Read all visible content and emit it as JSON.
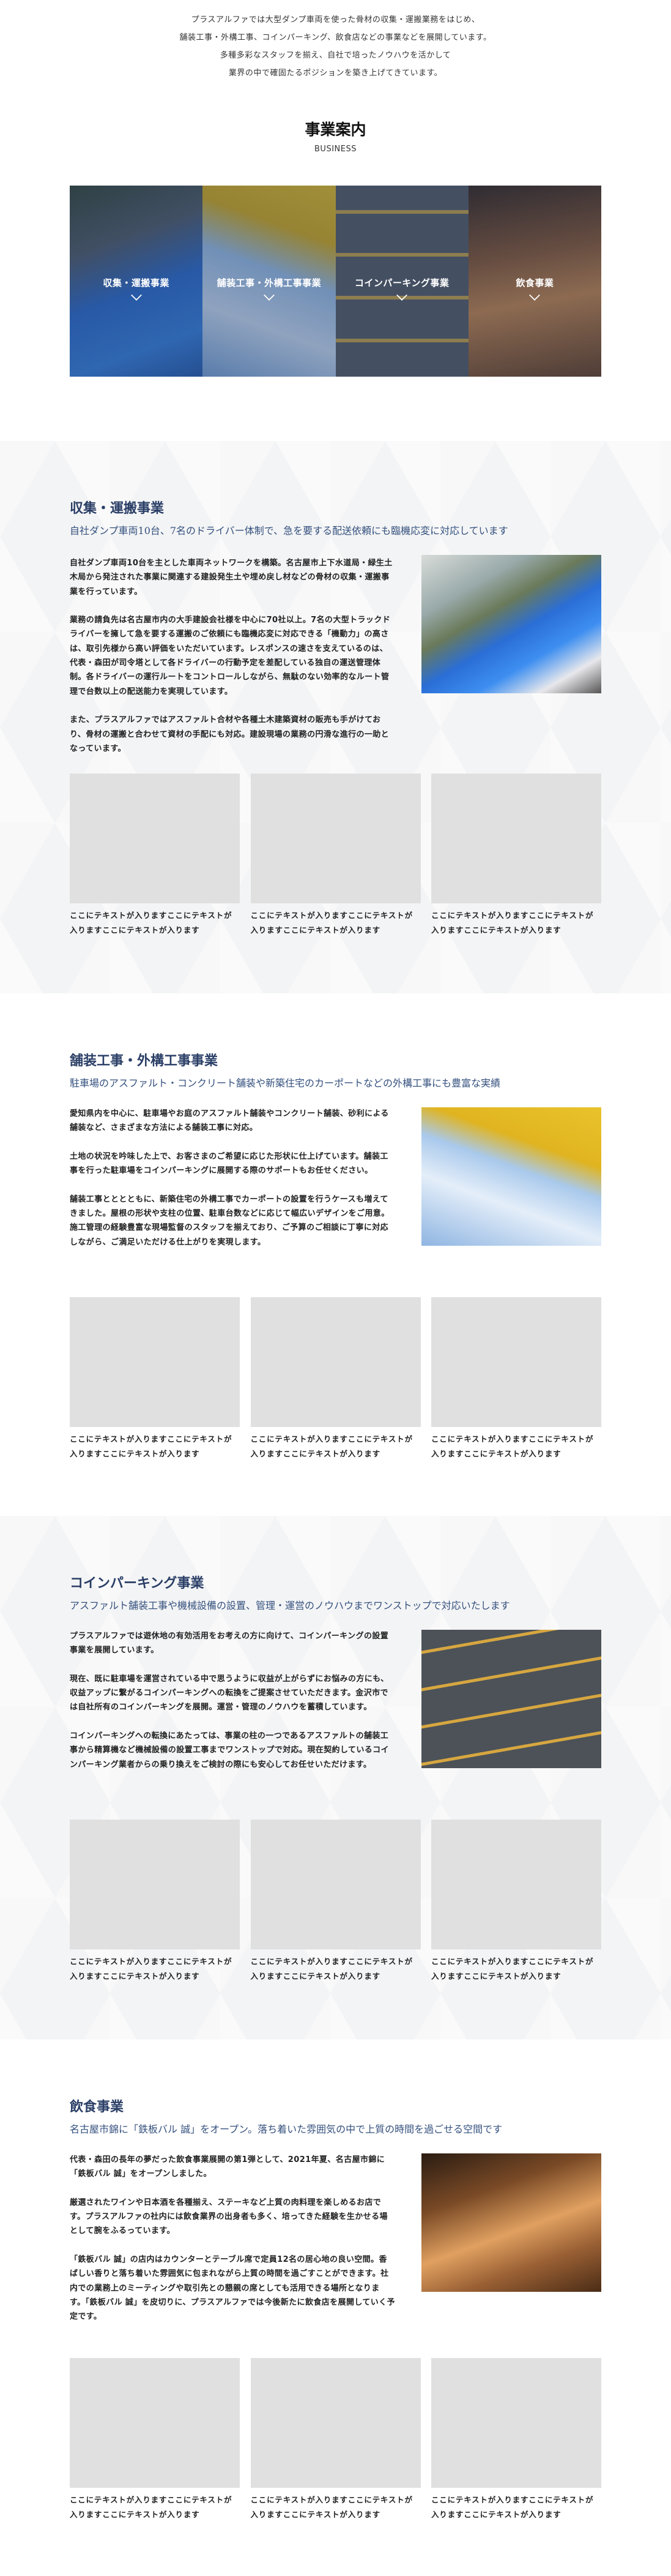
{
  "intro": {
    "lines": [
      "プラスアルファでは大型ダンプ車両を使った骨材の収集・運搬業務をはじめ、",
      "舗装工事・外構工事、コインパーキング、飲食店などの事業などを展開しています。",
      "多種多彩なスタッフを揃え、自社で培ったノウハウを活かして",
      "業界の中で確固たるポジションを築き上げてきています。"
    ]
  },
  "business": {
    "title": "事業案内",
    "subtitle": "BUSINESS",
    "tiles": [
      {
        "label": "収集・運搬事業"
      },
      {
        "label": "舗装工事・外構工事事業"
      },
      {
        "label": "コインパーキング事業"
      },
      {
        "label": "飲食事業"
      }
    ]
  },
  "sections": [
    {
      "title": "収集・運搬事業",
      "subtitle": "自社ダンプ車両10台、7名のドライバー体制で、急を要する配送依頼にも臨機応変に対応しています",
      "paragraphs": [
        "自社ダンプ車両10台を主とした車両ネットワークを構築。名古屋市上下水道局・緑生土木局から発注された事業に関連する建設発生土や埋め戻し材などの骨材の収集・運搬事業を行っています。",
        "業務の請負先は名古屋市内の大手建設会社様を中心に70社以上。7名の大型トラックドライバーを擁して急を要する運搬のご依頼にも臨機応変に対応できる「機動力」の高さは、取引先様から高い評価をいただいています。レスポンスの速さを支えているのは、代表・森田が司令塔として各ドライバーの行動予定を差配している独自の運送管理体制。各ドライバーの運行ルートをコントロールしながら、無駄のない効率的なルート管理で台数以上の配送能力を実現しています。",
        "また、プラスアルファではアスファルト合材や各種土木建築資材の販売も手がけており、骨材の運搬と合わせて資材の手配にも対応。建設現場の業務の円滑な進行の一助となっています。"
      ],
      "cards": [
        "ここにテキストが入りますここにテキストが入りますここにテキストが入ります",
        "ここにテキストが入りますここにテキストが入りますここにテキストが入ります",
        "ここにテキストが入りますここにテキストが入りますここにテキストが入ります"
      ]
    },
    {
      "title": "舗装工事・外構工事事業",
      "subtitle": "駐車場のアスファルト・コンクリート舗装や新築住宅のカーポートなどの外構工事にも豊富な実績",
      "paragraphs": [
        "愛知県内を中心に、駐車場やお庭のアスファルト舗装やコンクリート舗装、砂利による舗装など、さまざまな方法による舗装工事に対応。",
        "土地の状況を吟味した上で、お客さまのご希望に応じた形状に仕上げています。舗装工事を行った駐車場をコインパーキングに展開する際のサポートもお任せください。",
        "舗装工事とととともに、新築住宅の外構工事でカーポートの設置を行うケースも増えてきました。屋根の形状や支柱の位置、駐車台数などに応じて幅広いデザインをご用意。施工管理の経験豊富な現場監督のスタッフを揃えており、ご予算のご相談に丁寧に対応しながら、ご満足いただける仕上がりを実現します。"
      ],
      "cards": [
        "ここにテキストが入りますここにテキストが入りますここにテキストが入ります",
        "ここにテキストが入りますここにテキストが入りますここにテキストが入ります",
        "ここにテキストが入りますここにテキストが入りますここにテキストが入ります"
      ]
    },
    {
      "title": "コインパーキング事業",
      "subtitle": "アスファルト舗装工事や機械設備の設置、管理・運営のノウハウまでワンストップで対応いたします",
      "paragraphs": [
        "プラスアルファでは遊休地の有効活用をお考えの方に向けて、コインパーキングの設置事業を展開しています。",
        "現在、既に駐車場を運営されている中で思うように収益が上がらずにお悩みの方にも、収益アップに繋がるコインパーキングへの転換をご提案させていただきます。金沢市では自社所有のコインパーキングを展開。運営・管理のノウハウを蓄積しています。",
        "コインパーキングへの転換にあたっては、事業の柱の一つであるアスファルトの舗装工事から精算機など機械設備の設置工事までワンストップで対応。現在契約しているコインパーキング業者からの乗り換えをご検討の際にも安心してお任せいただけます。"
      ],
      "cards": [
        "ここにテキストが入りますここにテキストが入りますここにテキストが入ります",
        "ここにテキストが入りますここにテキストが入りますここにテキストが入ります",
        "ここにテキストが入りますここにテキストが入りますここにテキストが入ります"
      ]
    },
    {
      "title": "飲食事業",
      "subtitle": "名古屋市錦に「鉄板バル 誠」をオープン。落ち着いた雰囲気の中で上質の時間を過ごせる空間です",
      "paragraphs": [
        "代表・森田の長年の夢だった飲食事業展開の第1弾として、2021年夏、名古屋市錦に「鉄板バル 誠」をオープンしました。",
        "厳選されたワインや日本酒を各種揃え、ステーキなど上質の肉料理を楽しめるお店です。プラスアルファの社内には飲食業界の出身者も多く、培ってきた経験を生かせる場として腕をふるっています。",
        "「鉄板バル 誠」の店内はカウンターとテーブル席で定員12名の居心地の良い空間。香ばしい香りと落ち着いた雰囲気に包まれながら上質の時間を過ごすことができます。社内での業務上のミーティングや取引先との懇親の席としても活用できる場所となります。「鉄板バル 誠」を皮切りに、プラスアルファでは今後新たに飲食店を展開していく予定です。"
      ],
      "cards": [
        "ここにテキストが入りますここにテキストが入りますここにテキストが入ります",
        "ここにテキストが入りますここにテキストが入りますここにテキストが入ります",
        "ここにテキストが入りますここにテキストが入りますここにテキストが入ります"
      ]
    }
  ],
  "colors": {
    "heading": "#2a3e66",
    "subheading": "#34507e",
    "placeholder": "#e0e0e0",
    "section_bg": "#f3f4f5"
  }
}
